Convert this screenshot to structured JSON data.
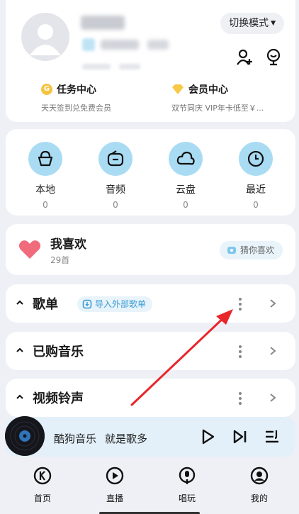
{
  "profile": {
    "mode_label": "切换模式",
    "task_center": {
      "title": "任务中心",
      "subtitle": "天天签到兑免费会员"
    },
    "vip_center": {
      "title": "会员中心",
      "subtitle": "双节同庆 VIP年卡低至￥..."
    }
  },
  "quick_access": [
    {
      "label": "本地",
      "count": "0",
      "icon": "local-icon"
    },
    {
      "label": "音频",
      "count": "0",
      "icon": "audio-icon"
    },
    {
      "label": "云盘",
      "count": "0",
      "icon": "cloud-icon"
    },
    {
      "label": "最近",
      "count": "0",
      "icon": "clock-icon"
    }
  ],
  "favorites": {
    "title": "我喜欢",
    "count": "29首",
    "guess_label": "猜你喜欢"
  },
  "rows": {
    "playlist": {
      "title": "歌单",
      "import_label": "导入外部歌单"
    },
    "purchased": {
      "title": "已购音乐"
    },
    "video": {
      "title": "视频铃声"
    }
  },
  "player": {
    "app": "酷狗音乐",
    "slogan": "就是歌多"
  },
  "nav": [
    {
      "label": "首页",
      "icon": "home-k-icon"
    },
    {
      "label": "直播",
      "icon": "live-icon"
    },
    {
      "label": "唱玩",
      "icon": "mic-icon"
    },
    {
      "label": "我的",
      "icon": "profile-icon"
    }
  ],
  "colors": {
    "accent": "#3a9bd5",
    "icon_bg": "#a9dcf3",
    "heart": "#f06b7b",
    "arrow": "#e8262c"
  }
}
